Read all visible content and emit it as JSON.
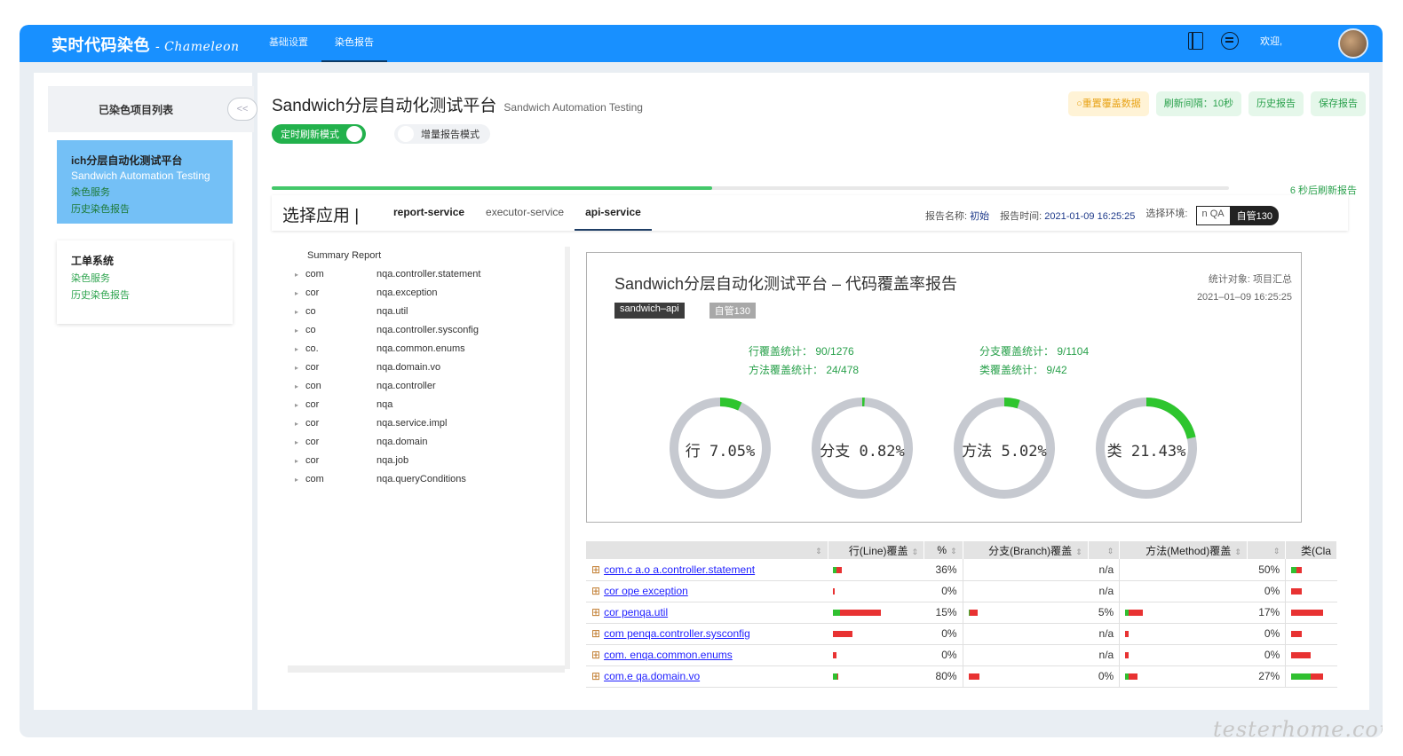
{
  "topbar": {
    "brand": "实时代码染色",
    "brand_sub": "- Chameleon",
    "nav": [
      "基础设置",
      "染色报告"
    ],
    "welcome": "欢迎,"
  },
  "sidebar": {
    "title": "已染色项目列表",
    "collapse_label": "<<",
    "projects": [
      {
        "name": "ich分层自动化测试平台",
        "en": "Sandwich Automation Testing",
        "service_link": "染色服务",
        "history_link": "历史染色报告"
      },
      {
        "name": "工单系统",
        "en": "",
        "service_link": "染色服务",
        "history_link": "历史染色报告"
      }
    ]
  },
  "main": {
    "title": "Sandwich分层自动化测试平台",
    "title_en": "Sandwich Automation Testing",
    "mode_timer": "定时刷新模式",
    "mode_incremental": "增量报告模式",
    "actions": {
      "reset": "○重置覆盖数据",
      "interval": "刷新间隔：10秒",
      "history": "历史报告",
      "save": "保存报告"
    },
    "refresh_progress": 0.46,
    "refresh_note": "6 秒后刷新报告",
    "app_label": "选择应用 |",
    "apps": [
      "report-service",
      "executor-service",
      "api-service"
    ],
    "report_name_label": "报告名称:",
    "report_name": "初始",
    "report_time_label": "报告时间:",
    "report_time": "2021-01-09 16:25:25",
    "env_label": "选择环境:",
    "envs": [
      "n QA",
      "自管130"
    ]
  },
  "tree": {
    "summary": "Summary Report",
    "items": [
      {
        "prefix": "com",
        "suffix": "nqa.controller.statement"
      },
      {
        "prefix": "cor",
        "suffix": "nqa.exception"
      },
      {
        "prefix": "co",
        "suffix": "nqa.util"
      },
      {
        "prefix": "co",
        "suffix": "nqa.controller.sysconfig"
      },
      {
        "prefix": "co.",
        "suffix": "nqa.common.enums"
      },
      {
        "prefix": "cor",
        "suffix": "nqa.domain.vo"
      },
      {
        "prefix": "con",
        "suffix": "nqa.controller"
      },
      {
        "prefix": "cor",
        "suffix": "nqa"
      },
      {
        "prefix": "cor",
        "suffix": "nqa.service.impl"
      },
      {
        "prefix": "cor",
        "suffix": "nqa.domain"
      },
      {
        "prefix": "cor",
        "suffix": "nqa.job"
      },
      {
        "prefix": "com",
        "suffix": "nqa.queryConditions"
      }
    ]
  },
  "summary": {
    "title": "Sandwich分层自动化测试平台 – 代码覆盖率报告",
    "target": "统计对象: 项目汇总",
    "time": "2021–01–09 16:25:25",
    "tags": [
      "sandwich–api",
      "自管130"
    ],
    "stats": {
      "line": "行覆盖统计： 90/1276",
      "branch": "分支覆盖统计： 9/1104",
      "method": "方法覆盖统计： 24/478",
      "class": "类覆盖统计： 9/42"
    },
    "donuts": [
      {
        "label": "行 7.05%",
        "value": 7.05
      },
      {
        "label": "分支 0.82%",
        "value": 0.82
      },
      {
        "label": "方法 5.02%",
        "value": 5.02
      },
      {
        "label": "类 21.43%",
        "value": 21.43
      }
    ],
    "colors": {
      "covered": "#2ec52e",
      "uncovered": "#c6c9d0"
    }
  },
  "table": {
    "headers": [
      "",
      "行(Line)覆盖",
      "%",
      "分支(Branch)覆盖",
      "",
      "方法(Method)覆盖",
      "",
      "类(Cla"
    ],
    "rows": [
      {
        "pkg": "com.c     a.o     a.controller.statement",
        "line_cov": 0.36,
        "line_pct": "36%",
        "branch_cov": null,
        "branch_pct": "n/a",
        "method_cov": null,
        "method_pct": "50%",
        "class_cov": 0.5
      },
      {
        "pkg": "cor        ope       exception",
        "line_cov": 0.0,
        "line_pct": "0%",
        "branch_cov": null,
        "branch_pct": "n/a",
        "method_cov": null,
        "method_pct": "0%",
        "class_cov": 0.0
      },
      {
        "pkg": "cor              penqa.util",
        "line_cov": 0.15,
        "line_pct": "15%",
        "branch_cov": 0.05,
        "branch_pct": "5%",
        "method_cov": 0.17,
        "method_pct": "17%",
        "class_cov": 0.0
      },
      {
        "pkg": "com             penqa.controller.sysconfig",
        "line_cov": 0.0,
        "line_pct": "0%",
        "branch_cov": null,
        "branch_pct": "n/a",
        "method_cov": 0.0,
        "method_pct": "0%",
        "class_cov": 0.0
      },
      {
        "pkg": "com.            enqa.common.enums",
        "line_cov": 0.0,
        "line_pct": "0%",
        "branch_cov": null,
        "branch_pct": "n/a",
        "method_cov": 0.0,
        "method_pct": "0%",
        "class_cov": 0.0
      },
      {
        "pkg": "com.e          qa.domain.vo",
        "line_cov": 0.8,
        "line_pct": "80%",
        "branch_cov": 0.0,
        "branch_pct": "0%",
        "method_cov": 0.27,
        "method_pct": "27%",
        "class_cov": 0.6
      }
    ]
  },
  "watermark": "testerhome.com"
}
